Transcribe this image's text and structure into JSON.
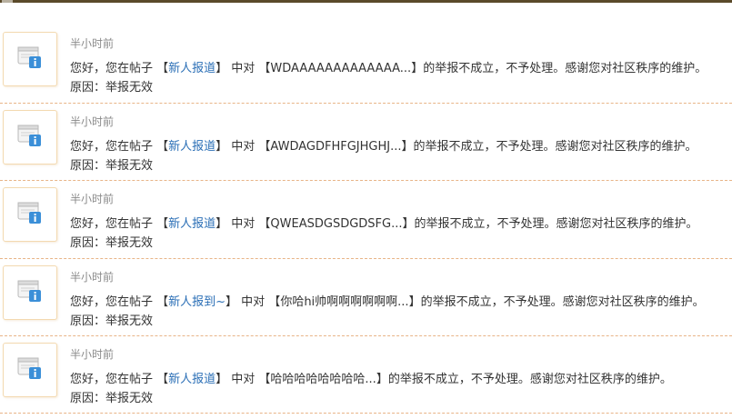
{
  "notifications": [
    {
      "time": "半小时前",
      "prefix": "您好，您在帖子 【",
      "post_link": "新人报道",
      "middle": "】 中对 【",
      "reported_content": "WDAAAAAAAAAAAAA...",
      "suffix": "】的举报不成立，不予处理。感谢您对社区秩序的维护。",
      "reason": "原因：举报无效"
    },
    {
      "time": "半小时前",
      "prefix": "您好，您在帖子 【",
      "post_link": "新人报道",
      "middle": "】 中对 【",
      "reported_content": "AWDAGDFHFGJHGHJ...",
      "suffix": "】的举报不成立，不予处理。感谢您对社区秩序的维护。",
      "reason": "原因：举报无效"
    },
    {
      "time": "半小时前",
      "prefix": "您好，您在帖子 【",
      "post_link": "新人报道",
      "middle": "】 中对 【",
      "reported_content": "QWEASDGSDGDSFG...",
      "suffix": "】的举报不成立，不予处理。感谢您对社区秩序的维护。",
      "reason": "原因：举报无效"
    },
    {
      "time": "半小时前",
      "prefix": "您好，您在帖子 【",
      "post_link": "新人报到~",
      "middle": "】 中对 【",
      "reported_content": "你哈hi帅啊啊啊啊啊啊...",
      "suffix": "】的举报不成立，不予处理。感谢您对社区秩序的维护。",
      "reason": "原因：举报无效"
    },
    {
      "time": "半小时前",
      "prefix": "您好，您在帖子 【",
      "post_link": "新人报道",
      "middle": "】 中对 【",
      "reported_content": "哈哈哈哈哈哈哈哈...",
      "suffix": "】的举报不成立，不予处理。感谢您对社区秩序的维护。",
      "reason": "原因：举报无效"
    }
  ],
  "colors": {
    "link": "#2b6fb6",
    "text": "#333333",
    "time": "#8a8a8a",
    "divider": "#e8b487",
    "icon_border": "#f3d9b0",
    "icon_blue": "#3b8fd8"
  },
  "icons": {
    "notification": "window-info-icon"
  }
}
